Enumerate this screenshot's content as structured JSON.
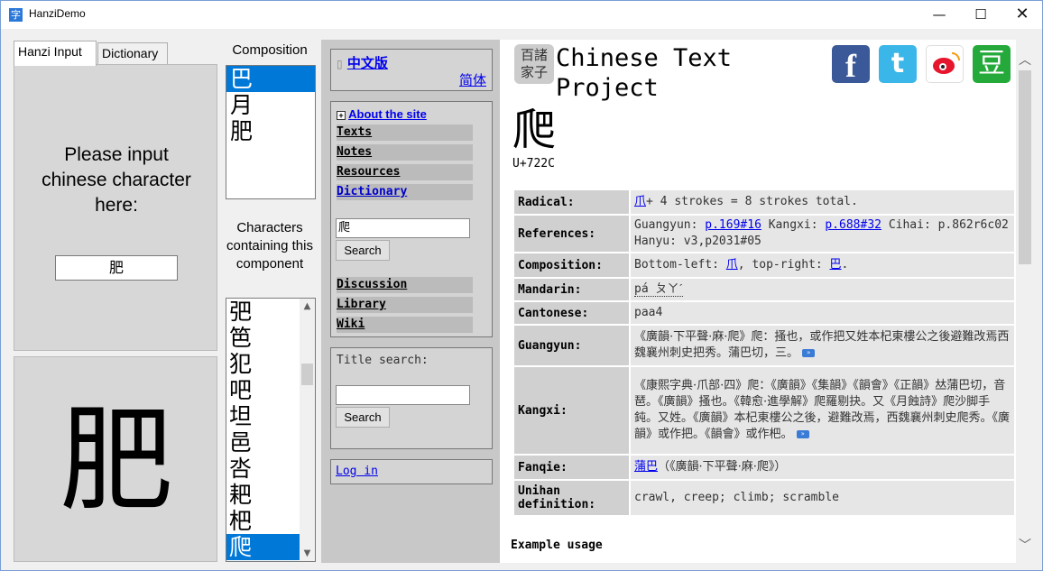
{
  "window": {
    "title": "HanziDemo",
    "min_glyph": "—",
    "max_glyph": "☐",
    "close_glyph": "✕"
  },
  "tabs": [
    {
      "label": "Hanzi Input",
      "active": true
    },
    {
      "label": "Dictionary",
      "active": false
    }
  ],
  "input_panel": {
    "prompt": "Please input chinese character here:",
    "value": "肥"
  },
  "big_char": "肥",
  "composition": {
    "label": "Composition",
    "items": [
      "巴",
      "月",
      "肥"
    ],
    "selected": 0
  },
  "containing": {
    "label": "Characters containing this component",
    "items": [
      "弝",
      "笆",
      "犯",
      "吧",
      "坦",
      "邑",
      "呇",
      "耙",
      "杷",
      "爬"
    ],
    "selected": 9
  },
  "side": {
    "lang_link": "中文版",
    "simplified_link": "简体",
    "about_link": "About the site",
    "nav": [
      "Texts",
      "Notes",
      "Resources",
      "Dictionary"
    ],
    "dict_search_value": "爬",
    "search_btn": "Search",
    "nav2": [
      "Discussion",
      "Library",
      "Wiki"
    ],
    "title_search_label": "Title search:",
    "title_search_value": "",
    "search_btn2": "Search",
    "login_link": "Log in"
  },
  "content": {
    "logo_text": "百諸家子",
    "site_title_line1": "Chinese Text",
    "site_title_line2": "Project",
    "headword": "爬",
    "codepoint": "U+722C",
    "rows": {
      "radical_label": "Radical:",
      "radical_link": "爪",
      "radical_rest": "+ 4 strokes = 8 strokes total.",
      "references_label": "References:",
      "ref_guangyun": "Guangyun:",
      "ref_guangyun_link": "p.169#16",
      "ref_kangxi": "Kangxi:",
      "ref_kangxi_link": "p.688#32",
      "ref_rest": "Cihai: p.862r6c02 Hanyu: v3,p2031#05",
      "composition_label": "Composition:",
      "comp_text1": "Bottom-left:",
      "comp_link1": "爪",
      "comp_text2": ", top-right:",
      "comp_link2": "巴",
      "comp_end": ".",
      "mandarin_label": "Mandarin:",
      "mandarin_value": "pá ㄆㄚˊ",
      "cantonese_label": "Cantonese:",
      "cantonese_value": "paa4",
      "guangyun_label": "Guangyun:",
      "guangyun_value": "《廣韻·下平聲·麻·爬》爬：搔也，或作把又姓本杞東樓公之後避難改焉西魏襄州刺史把秀。蒲巴切，三。",
      "kangxi_label": "Kangxi:",
      "kangxi_value": "《康熙字典·爪部·四》爬：《廣韻》《集韻》《韻會》《正韻》𠀤蒲巴切，音琶。《廣韻》搔也。《韓愈·進學解》爬羅剔抉。又《月蝕詩》爬沙脚手鈍。又姓。《廣韻》本杞東樓公之後，避難改焉，西魏襄州刺史爬秀。《廣韻》或作把。《韻會》或作杷。",
      "fanqie_label": "Fanqie:",
      "fanqie_link": "蒲巴",
      "fanqie_rest": "（《廣韻·下平聲·麻·爬》）",
      "unihan_label": "Unihan definition:",
      "unihan_value": "crawl, creep; climb; scramble"
    },
    "example_label": "Example usage"
  }
}
